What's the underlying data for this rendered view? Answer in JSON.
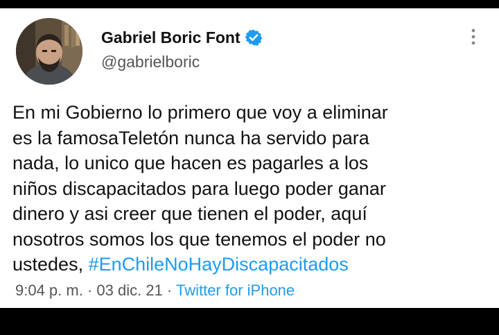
{
  "author": {
    "display_name": "Gabriel Boric Font",
    "handle": "@gabrielboric",
    "verified": true,
    "verified_icon": "verified-badge-icon",
    "avatar_icon": "avatar"
  },
  "tweet": {
    "lines": [
      "En mi Gobierno lo primero que voy a eliminar",
      "es la famosaTeletón nunca ha servido para",
      "nada, lo unico que hacen es pagarles a los",
      "niños discapacitados para luego poder ganar",
      "dinero y asi creer que tienen el poder, aquí",
      "nosotros somos los que tenemos el poder no",
      "ustedes, "
    ],
    "hashtag": "#EnChileNoHayDiscapacitados"
  },
  "meta": {
    "time": "9:04 p. m.",
    "sep1": " · ",
    "date": "03 dic. 21",
    "sep2": " · ",
    "source": "Twitter for iPhone"
  },
  "menu": {
    "icon": "more-options-icon"
  },
  "colors": {
    "link": "#1d9bf0",
    "text": "#111111",
    "secondary": "#555555",
    "frame": "#000000",
    "card": "#ffffff"
  }
}
